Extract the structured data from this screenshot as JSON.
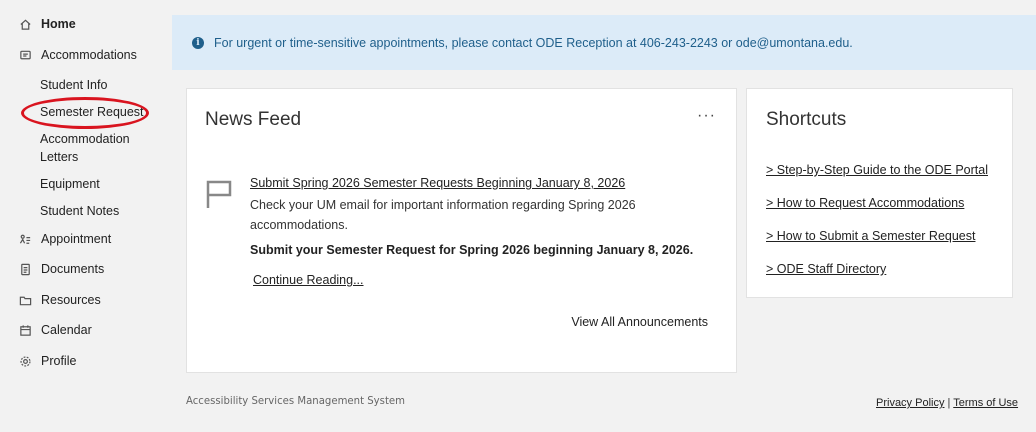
{
  "sidebar": {
    "home": "Home",
    "accommodations": "Accommodations",
    "sub": {
      "student_info": "Student Info",
      "semester_request": "Semester Request",
      "accommodation_letters": "Accommodation Letters",
      "equipment": "Equipment",
      "student_notes": "Student Notes"
    },
    "appointment": "Appointment",
    "documents": "Documents",
    "resources": "Resources",
    "calendar": "Calendar",
    "profile": "Profile"
  },
  "alert": {
    "text": "For urgent or time-sensitive appointments, please contact ODE Reception at 406-243-2243 or ode@umontana.edu."
  },
  "news": {
    "title": "News Feed",
    "more": "···",
    "post_title": "Submit Spring 2026 Semester Requests Beginning January 8, 2026",
    "post_body": "Check your UM email for important information regarding Spring 2026 accommodations.",
    "post_bold": "Submit your Semester Request for Spring 2026 beginning January 8, 2026.",
    "continue": "Continue Reading...",
    "view_all": "View All Announcements"
  },
  "shortcuts": {
    "title": "Shortcuts",
    "links": [
      "> Step-by-Step Guide to the ODE Portal",
      "> How to Request Accommodations",
      "> How to Submit a Semester Request",
      "> ODE Staff Directory"
    ]
  },
  "footer": {
    "system": "Accessibility Services Management System",
    "privacy": "Privacy Policy",
    "separator": "|",
    "terms": "Terms of Use"
  },
  "colors": {
    "alert_bg": "#dcebf8",
    "alert_text": "#1f5f8b",
    "highlight_circle": "#d9141f"
  }
}
